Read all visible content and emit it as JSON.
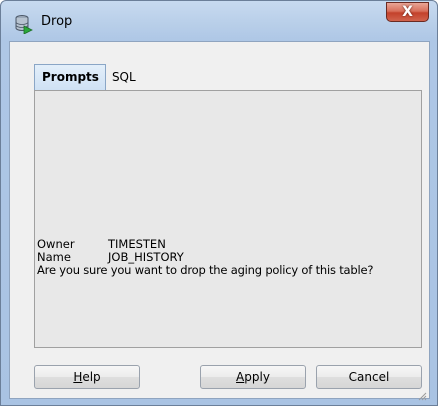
{
  "window": {
    "title": "Drop",
    "close_label": "X",
    "icon": "database-drop-icon",
    "close_icon": "close-icon"
  },
  "tabs": [
    {
      "label": "Prompts",
      "active": true
    },
    {
      "label": "SQL",
      "active": false
    }
  ],
  "prompts": {
    "owner_label": "Owner",
    "owner_value": "TIMESTEN",
    "name_label": "Name",
    "name_value": "JOB_HISTORY",
    "question": "Are you sure you want to drop the aging policy of this table?"
  },
  "buttons": {
    "help": {
      "mnemonic": "H",
      "rest": "elp"
    },
    "apply": {
      "mnemonic": "A",
      "rest": "pply"
    },
    "cancel": "Cancel"
  },
  "colors": {
    "close_button": "#c3412b",
    "active_tab": "#cfe1f4",
    "frame": "#b9cfe9"
  }
}
